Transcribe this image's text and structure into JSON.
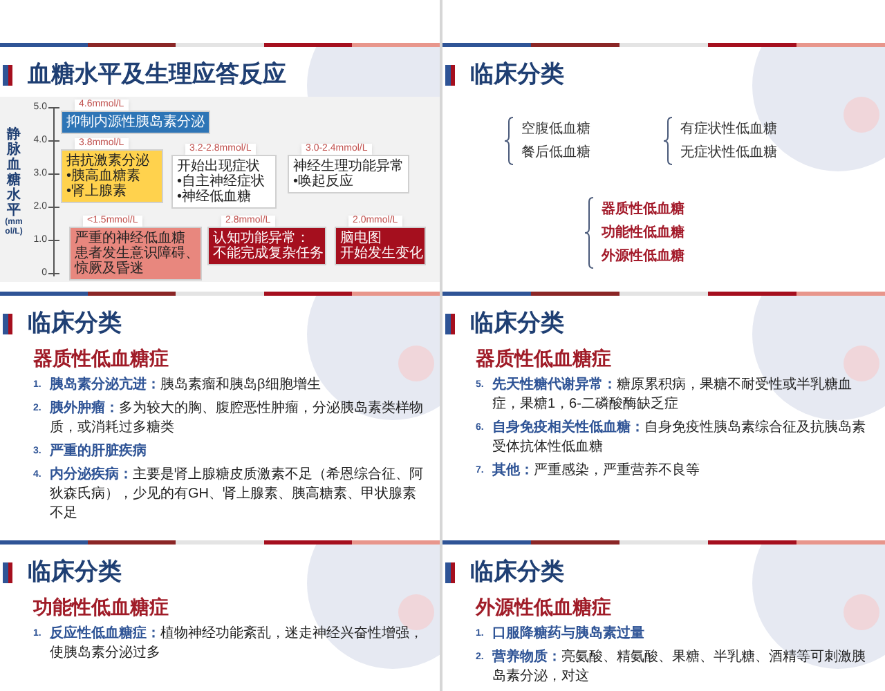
{
  "slides": [
    {
      "kind": "blank"
    },
    {
      "kind": "blank"
    },
    {
      "kind": "diagram",
      "title": "血糖水平及生理应答反应",
      "axis": {
        "label": "静脉血糖水平",
        "unit": "(mmol/L)",
        "ticks": [
          "5.0",
          "4.0",
          "3.0",
          "2.0",
          "1.0",
          "0"
        ]
      },
      "nodes": [
        {
          "tag": "4.6mmol/L",
          "lines": [
            "抑制内源性胰岛素分泌"
          ],
          "color": "#2e75b6"
        },
        {
          "tag": "3.8mmol/L",
          "lines": [
            "拮抗激素分泌",
            "•胰高血糖素",
            "•肾上腺素"
          ],
          "color": "#ffd24d"
        },
        {
          "tag": "3.2-2.8mmol/L",
          "lines": [
            "开始出现症状",
            "•自主神经症状",
            "•神经低血糖"
          ],
          "color": "#ffffff"
        },
        {
          "tag": "3.0-2.4mmol/L",
          "lines": [
            "神经生理功能异常",
            "•唤起反应"
          ],
          "color": "#ffffff"
        },
        {
          "tag": "<1.5mmol/L",
          "lines": [
            "严重的神经低血糖",
            "患者发生意识障碍、",
            "惊厥及昏迷"
          ],
          "color": "#e8877e"
        },
        {
          "tag": "2.8mmol/L",
          "lines": [
            "认知功能异常：",
            "不能完成复杂任务"
          ],
          "color": "#a50f1e"
        },
        {
          "tag": "2.0mmol/L",
          "lines": [
            "脑电图",
            "开始发生变化"
          ],
          "color": "#a50f1e"
        }
      ]
    },
    {
      "kind": "groups",
      "title": "临床分类",
      "groups": [
        {
          "emphasis": false,
          "items": [
            "空腹低血糖",
            "餐后低血糖"
          ]
        },
        {
          "emphasis": false,
          "items": [
            "有症状性低血糖",
            "无症状性低血糖"
          ]
        },
        {
          "emphasis": true,
          "items": [
            "器质性低血糖",
            "功能性低血糖",
            "外源性低血糖"
          ]
        }
      ]
    },
    {
      "kind": "list",
      "title": "临床分类",
      "subtitle": "器质性低血糖症",
      "items": [
        {
          "number": "1.",
          "term": "胰岛素分泌亢进：",
          "text": "胰岛素瘤和胰岛β细胞增生"
        },
        {
          "number": "2.",
          "term": "胰外肿瘤：",
          "text": "多为较大的胸、腹腔恶性肿瘤，分泌胰岛素类样物质，或消耗过多糖类"
        },
        {
          "number": "3.",
          "term": "严重的肝脏疾病"
        },
        {
          "number": "4.",
          "term": "内分泌疾病：",
          "text": "主要是肾上腺糖皮质激素不足（希恩综合征、阿狄森氏病），少见的有GH、肾上腺素、胰高糖素、甲状腺素不足"
        }
      ]
    },
    {
      "kind": "list",
      "title": "临床分类",
      "subtitle": "器质性低血糖症",
      "items": [
        {
          "number": "5.",
          "term": "先天性糖代谢异常：",
          "text": "糖原累积病，果糖不耐受性或半乳糖血症，果糖1，6-二磷酸酶缺乏症"
        },
        {
          "number": "6.",
          "term": "自身免疫相关性低血糖：",
          "text": "自身免疫性胰岛素综合征及抗胰岛素受体抗体性低血糖"
        },
        {
          "number": "7.",
          "term": "其他：",
          "text": "严重感染，严重营养不良等"
        }
      ]
    },
    {
      "kind": "list",
      "title": "临床分类",
      "subtitle": "功能性低血糖症",
      "items": [
        {
          "number": "1.",
          "term": "反应性低血糖症：",
          "text": "植物神经功能紊乱，迷走神经兴奋性增强，使胰岛素分泌过多"
        }
      ]
    },
    {
      "kind": "list",
      "title": "临床分类",
      "subtitle": "外源性低血糖症",
      "items": [
        {
          "number": "1.",
          "term": "口服降糖药与胰岛素过量"
        },
        {
          "number": "2.",
          "term": "营养物质：",
          "text": "亮氨酸、精氨酸、果糖、半乳糖、酒精等可刺激胰岛素分泌，对这"
        }
      ]
    }
  ]
}
